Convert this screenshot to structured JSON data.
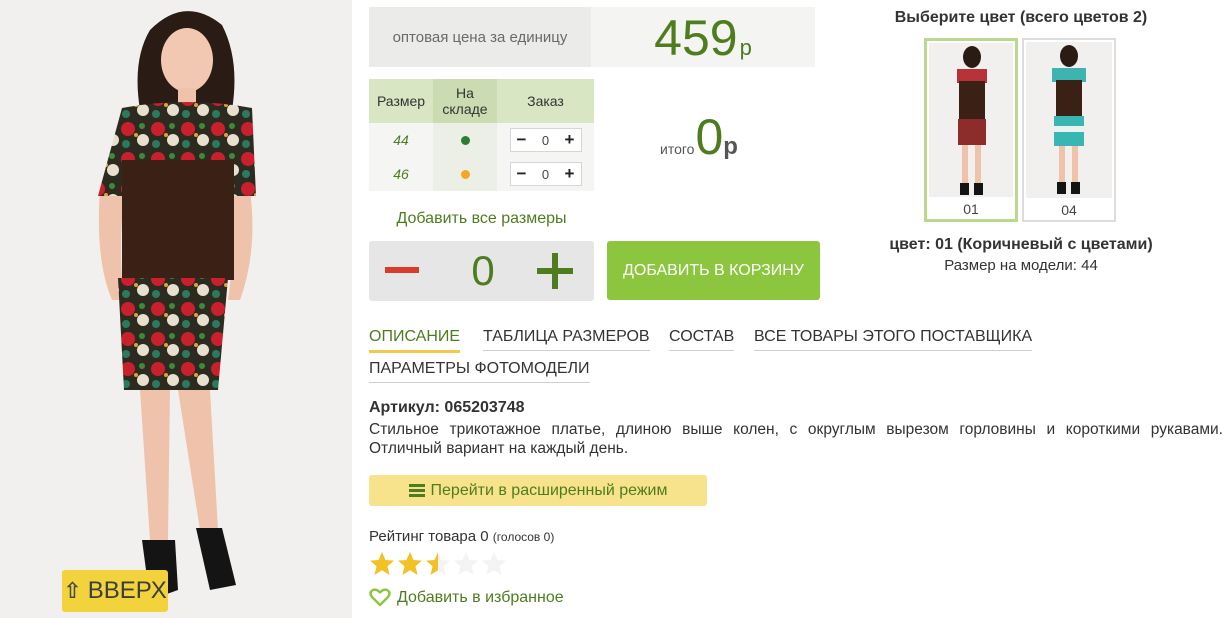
{
  "price": {
    "label": "оптовая цена за единицу",
    "value": "459",
    "currency": "р"
  },
  "sizes": {
    "headers": {
      "size": "Размер",
      "stock": "На складе",
      "order": "Заказ"
    },
    "rows": [
      {
        "size": "44",
        "stock_color": "#2e7d32",
        "qty": "0"
      },
      {
        "size": "46",
        "stock_color": "#f5a623",
        "qty": "0"
      }
    ]
  },
  "total": {
    "label": "итого",
    "value": "0",
    "currency": "р"
  },
  "add_all_sizes": "Добавить все размеры",
  "quantity": {
    "value": "0"
  },
  "cart_button": "ДОБАВИТЬ В КОРЗИНУ",
  "colors": {
    "title": "Выберите цвет (всего цветов 2)",
    "items": [
      {
        "code": "01",
        "selected": true
      },
      {
        "code": "04",
        "selected": false
      }
    ],
    "selected_name": "цвет: 01 (Коричневый с цветами)",
    "model_size": "Размер на модели: 44"
  },
  "tabs": [
    {
      "label": "ОПИСАНИЕ",
      "active": true
    },
    {
      "label": "ТАБЛИЦА РАЗМЕРОВ",
      "active": false
    },
    {
      "label": "СОСТАВ",
      "active": false
    },
    {
      "label": "ВСЕ ТОВАРЫ ЭТОГО ПОСТАВЩИКА",
      "active": false
    },
    {
      "label": "ПАРАМЕТРЫ ФОТОМОДЕЛИ",
      "active": false
    }
  ],
  "article": "Артикул: 065203748",
  "description": "Стильное трикотажное платье, длиною выше колен, с округлым вырезом горловины и короткими рукавами. Отличный вариант на каждый день.",
  "advanced_mode": "Перейти в расширенный режим",
  "rating": {
    "label": "Рейтинг товара 0",
    "votes": "(голосов 0)",
    "stars": 2.5,
    "max": 5
  },
  "favorite": "Добавить в избранное",
  "scroll_up": "ВВЕРХ",
  "colors_palette": {
    "accent_green": "#4f7c1f",
    "button_green": "#8cc63f",
    "yellow": "#f2d33c"
  }
}
